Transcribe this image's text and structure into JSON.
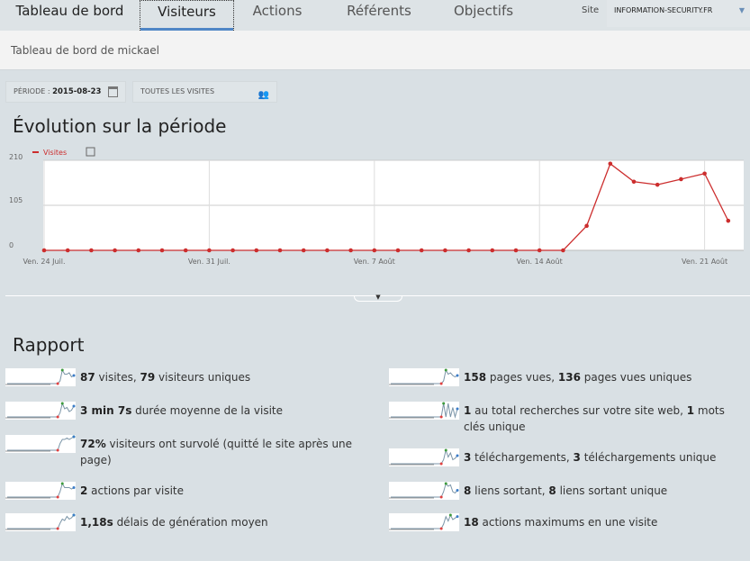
{
  "nav": {
    "tabs": [
      "Tableau de bord",
      "Visiteurs",
      "Actions",
      "Référents",
      "Objectifs"
    ],
    "site_label": "Site",
    "site_value": "INFORMATION-SECURITY.FR"
  },
  "subheader": "Tableau de bord de mickael",
  "period": {
    "label": "PÉRIODE : ",
    "value": "2015-08-23"
  },
  "segment": "TOUTES LES VISITES",
  "evolution_title": "Évolution sur la période",
  "rapport_title": "Rapport",
  "chart_data": {
    "type": "line",
    "title": "Évolution sur la période",
    "legend": "Visites",
    "series_color": "#cc2d2d",
    "ylim": [
      0,
      210
    ],
    "yticks": [
      "0",
      "105",
      "210"
    ],
    "x": [
      "24 Juil",
      "25 Juil",
      "26 Juil",
      "27 Juil",
      "28 Juil",
      "29 Juil",
      "30 Juil",
      "31 Juil",
      "1 Août",
      "2 Août",
      "3 Août",
      "4 Août",
      "5 Août",
      "6 Août",
      "7 Août",
      "8 Août",
      "9 Août",
      "10 Août",
      "11 Août",
      "12 Août",
      "13 Août",
      "14 Août",
      "15 Août",
      "16 Août",
      "17 Août",
      "18 Août",
      "19 Août",
      "20 Août",
      "21 Août",
      "22 Août"
    ],
    "values": [
      0,
      0,
      0,
      0,
      0,
      0,
      0,
      0,
      0,
      0,
      0,
      0,
      0,
      0,
      0,
      0,
      0,
      0,
      0,
      0,
      0,
      0,
      0,
      57,
      202,
      160,
      153,
      166,
      179,
      69
    ],
    "xticks": [
      {
        "i": 0,
        "label": "Ven. 24 Juil."
      },
      {
        "i": 7,
        "label": "Ven. 31 Juil."
      },
      {
        "i": 14,
        "label": "Ven. 7 Août"
      },
      {
        "i": 21,
        "label": "Ven. 14 Août"
      },
      {
        "i": 28,
        "label": "Ven. 21 Août"
      }
    ]
  },
  "report_left": [
    {
      "parts": [
        [
          "87",
          true
        ],
        [
          " visites, ",
          false
        ],
        [
          "79",
          true
        ],
        [
          " visiteurs uniques",
          false
        ]
      ],
      "trend": [
        0,
        0,
        0,
        0,
        0,
        0,
        0,
        0,
        0,
        0,
        0,
        0,
        0,
        0,
        0,
        0,
        0,
        0,
        0,
        0,
        0,
        0,
        0,
        2,
        10,
        7,
        7,
        8,
        5,
        6
      ]
    },
    {
      "parts": [
        [
          "3 min 7s",
          true
        ],
        [
          " durée moyenne de la visite",
          false
        ]
      ],
      "trend": [
        0,
        0,
        0,
        0,
        0,
        0,
        0,
        0,
        0,
        0,
        0,
        0,
        0,
        0,
        0,
        0,
        0,
        0,
        0,
        0,
        0,
        0,
        0,
        3,
        10,
        6,
        7,
        4,
        5,
        8
      ]
    },
    {
      "parts": [
        [
          "72%",
          true
        ],
        [
          " visiteurs ont survolé (quitté le site après une page)",
          false
        ]
      ],
      "trend": [
        0,
        0,
        0,
        0,
        0,
        0,
        0,
        0,
        0,
        0,
        0,
        0,
        0,
        0,
        0,
        0,
        0,
        0,
        0,
        0,
        0,
        0,
        0,
        5,
        8,
        8,
        9,
        8,
        9,
        10
      ]
    },
    {
      "parts": [
        [
          "2",
          true
        ],
        [
          " actions par visite",
          false
        ]
      ],
      "trend": [
        0,
        0,
        0,
        0,
        0,
        0,
        0,
        0,
        0,
        0,
        0,
        0,
        0,
        0,
        0,
        0,
        0,
        0,
        0,
        0,
        0,
        0,
        0,
        4,
        10,
        7,
        7,
        7,
        6,
        7
      ]
    },
    {
      "parts": [
        [
          "1,18s",
          true
        ],
        [
          " délais de génération moyen",
          false
        ]
      ],
      "trend": [
        0,
        0,
        0,
        0,
        0,
        0,
        0,
        0,
        0,
        0,
        0,
        0,
        0,
        0,
        0,
        0,
        0,
        0,
        0,
        0,
        0,
        0,
        0,
        4,
        7,
        6,
        9,
        7,
        8,
        10
      ]
    }
  ],
  "report_right": [
    {
      "parts": [
        [
          "158",
          true
        ],
        [
          " pages vues, ",
          false
        ],
        [
          "136",
          true
        ],
        [
          " pages vues uniques",
          false
        ]
      ],
      "trend": [
        0,
        0,
        0,
        0,
        0,
        0,
        0,
        0,
        0,
        0,
        0,
        0,
        0,
        0,
        0,
        0,
        0,
        0,
        0,
        0,
        0,
        0,
        0,
        2,
        10,
        7,
        8,
        6,
        5,
        6
      ]
    },
    {
      "parts": [
        [
          "1",
          true
        ],
        [
          " au total recherches sur votre site web, ",
          false
        ],
        [
          "1",
          true
        ],
        [
          " mots clés unique",
          false
        ]
      ],
      "trend": [
        0,
        0,
        0,
        0,
        0,
        0,
        0,
        0,
        0,
        0,
        0,
        0,
        0,
        0,
        0,
        0,
        0,
        0,
        0,
        0,
        0,
        0,
        0,
        10,
        0,
        10,
        0,
        7,
        0,
        6
      ]
    },
    {
      "parts": [
        [
          "3",
          true
        ],
        [
          " téléchargements, ",
          false
        ],
        [
          "3",
          true
        ],
        [
          " téléchargements unique",
          false
        ]
      ],
      "trend": [
        0,
        0,
        0,
        0,
        0,
        0,
        0,
        0,
        0,
        0,
        0,
        0,
        0,
        0,
        0,
        0,
        0,
        0,
        0,
        0,
        0,
        0,
        0,
        3,
        10,
        5,
        8,
        3,
        4,
        6
      ]
    },
    {
      "parts": [
        [
          "8",
          true
        ],
        [
          " liens sortant, ",
          false
        ],
        [
          "8",
          true
        ],
        [
          " liens sortant unique",
          false
        ]
      ],
      "trend": [
        0,
        0,
        0,
        0,
        0,
        0,
        0,
        0,
        0,
        0,
        0,
        0,
        0,
        0,
        0,
        0,
        0,
        0,
        0,
        0,
        0,
        0,
        0,
        4,
        10,
        8,
        9,
        4,
        3,
        5
      ]
    },
    {
      "parts": [
        [
          "18",
          true
        ],
        [
          " actions maximums en une visite",
          false
        ]
      ],
      "trend": [
        0,
        0,
        0,
        0,
        0,
        0,
        0,
        0,
        0,
        0,
        0,
        0,
        0,
        0,
        0,
        0,
        0,
        0,
        0,
        0,
        0,
        0,
        0,
        3,
        8,
        5,
        9,
        6,
        7,
        8
      ]
    }
  ]
}
